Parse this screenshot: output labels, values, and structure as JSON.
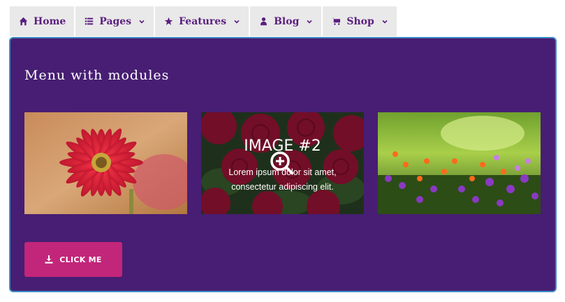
{
  "nav": {
    "items": [
      {
        "label": "Home",
        "icon": "home-icon",
        "dropdown": false
      },
      {
        "label": "Pages",
        "icon": "list-icon",
        "dropdown": true
      },
      {
        "label": "Features",
        "icon": "star-icon",
        "dropdown": true
      },
      {
        "label": "Blog",
        "icon": "user-icon",
        "dropdown": true
      },
      {
        "label": "Shop",
        "icon": "cart-icon",
        "dropdown": true
      }
    ]
  },
  "panel": {
    "title": "Menu with modules",
    "images": [
      {
        "subject": "red gerbera flower"
      },
      {
        "subject": "red roses",
        "overlay_title": "IMAGE #2",
        "overlay_text": "Lorem ipsum dolor sit amet, consectetur adipiscing elit."
      },
      {
        "subject": "garden flowers"
      }
    ],
    "button_label": "CLICK ME",
    "button_icon": "download-icon"
  },
  "colors": {
    "panel_bg": "#471e73",
    "nav_bg": "#e9e9e9",
    "nav_text": "#5b1f7f",
    "button_bg": "#c2267a",
    "panel_border": "#3a8bc4"
  }
}
